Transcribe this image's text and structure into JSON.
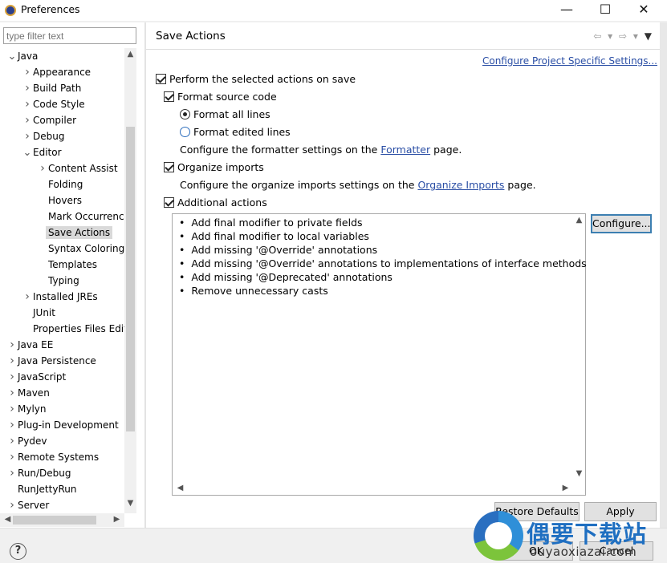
{
  "window": {
    "title": "Preferences",
    "controls": {
      "minimize": "—",
      "maximize": "☐",
      "close": "✕"
    }
  },
  "filter": {
    "placeholder": "type filter text"
  },
  "tree": [
    {
      "label": "Java",
      "level": 0,
      "twisty": "expanded"
    },
    {
      "label": "Appearance",
      "level": 1,
      "twisty": "collapsed"
    },
    {
      "label": "Build Path",
      "level": 1,
      "twisty": "collapsed"
    },
    {
      "label": "Code Style",
      "level": 1,
      "twisty": "collapsed"
    },
    {
      "label": "Compiler",
      "level": 1,
      "twisty": "collapsed"
    },
    {
      "label": "Debug",
      "level": 1,
      "twisty": "collapsed"
    },
    {
      "label": "Editor",
      "level": 1,
      "twisty": "expanded"
    },
    {
      "label": "Content Assist",
      "level": 2,
      "twisty": "collapsed"
    },
    {
      "label": "Folding",
      "level": 2,
      "twisty": "none"
    },
    {
      "label": "Hovers",
      "level": 2,
      "twisty": "none"
    },
    {
      "label": "Mark Occurrences",
      "level": 2,
      "twisty": "none"
    },
    {
      "label": "Save Actions",
      "level": 2,
      "twisty": "none",
      "selected": true
    },
    {
      "label": "Syntax Coloring",
      "level": 2,
      "twisty": "none"
    },
    {
      "label": "Templates",
      "level": 2,
      "twisty": "none"
    },
    {
      "label": "Typing",
      "level": 2,
      "twisty": "none"
    },
    {
      "label": "Installed JREs",
      "level": 1,
      "twisty": "collapsed"
    },
    {
      "label": "JUnit",
      "level": 1,
      "twisty": "none"
    },
    {
      "label": "Properties Files Editor",
      "level": 1,
      "twisty": "none"
    },
    {
      "label": "Java EE",
      "level": 0,
      "twisty": "collapsed"
    },
    {
      "label": "Java Persistence",
      "level": 0,
      "twisty": "collapsed"
    },
    {
      "label": "JavaScript",
      "level": 0,
      "twisty": "collapsed"
    },
    {
      "label": "Maven",
      "level": 0,
      "twisty": "collapsed"
    },
    {
      "label": "Mylyn",
      "level": 0,
      "twisty": "collapsed"
    },
    {
      "label": "Plug-in Development",
      "level": 0,
      "twisty": "collapsed"
    },
    {
      "label": "Pydev",
      "level": 0,
      "twisty": "collapsed"
    },
    {
      "label": "Remote Systems",
      "level": 0,
      "twisty": "collapsed"
    },
    {
      "label": "Run/Debug",
      "level": 0,
      "twisty": "collapsed"
    },
    {
      "label": "RunJettyRun",
      "level": 0,
      "twisty": "none"
    },
    {
      "label": "Server",
      "level": 0,
      "twisty": "collapsed"
    }
  ],
  "page": {
    "title": "Save Actions",
    "configure_project_link": "Configure Project Specific Settings...",
    "perform_actions": {
      "label": "Perform the selected actions on save",
      "checked": true
    },
    "format_source": {
      "label": "Format source code",
      "checked": true
    },
    "format_all": {
      "label": "Format all lines",
      "selected": true
    },
    "format_edited": {
      "label": "Format edited lines",
      "selected": false
    },
    "formatter_text_before": "Configure the formatter settings on the",
    "formatter_link": "Formatter",
    "formatter_text_after": "page.",
    "organize_imports": {
      "label": "Organize imports",
      "checked": true
    },
    "organize_text_before": "Configure the organize imports settings on the",
    "organize_link": "Organize Imports",
    "organize_text_after": "page.",
    "additional_actions": {
      "label": "Additional actions",
      "checked": true
    },
    "actions": [
      "Add final modifier to private fields",
      "Add final modifier to local variables",
      "Add missing '@Override' annotations",
      "Add missing '@Override' annotations to implementations of interface methods",
      "Add missing '@Deprecated' annotations",
      "Remove unnecessary casts"
    ],
    "configure_button": "Configure...",
    "restore_defaults": "Restore Defaults",
    "apply": "Apply"
  },
  "footer": {
    "help": "?",
    "ok": "OK",
    "cancel": "Cancel"
  },
  "watermark": {
    "chinese": "偶要下载站",
    "domain": "ouyaoxiazai.com"
  },
  "icons": {
    "back": "back-arrow-icon",
    "forward": "forward-arrow-icon",
    "menu": "view-menu-icon",
    "help": "help-icon",
    "app": "eclipse-icon"
  },
  "colors": {
    "link": "#2a4ea5",
    "selection": "#d9d9d9",
    "focus": "#3c7fb1",
    "watermark": "#1f6fc1"
  }
}
